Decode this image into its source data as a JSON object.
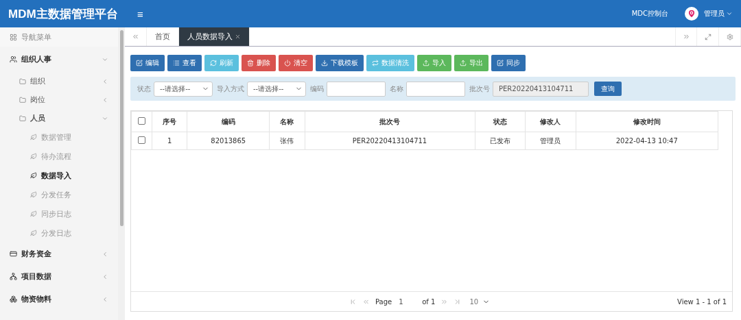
{
  "header": {
    "title": "MDM主数据管理平台",
    "menu_toggle": "≡",
    "console_link": "MDC控制台",
    "user": "管理员"
  },
  "sidebar": {
    "title": "导航菜单",
    "items": [
      {
        "label": "组织人事",
        "expanded": true,
        "children": [
          {
            "label": "组织",
            "expanded": false
          },
          {
            "label": "岗位",
            "expanded": false
          },
          {
            "label": "人员",
            "expanded": true,
            "children": [
              {
                "label": "数据管理",
                "selected": false
              },
              {
                "label": "待办流程",
                "selected": false
              },
              {
                "label": "数据导入",
                "selected": true
              },
              {
                "label": "分发任务",
                "selected": false
              },
              {
                "label": "同步日志",
                "selected": false
              },
              {
                "label": "分发日志",
                "selected": false
              }
            ]
          }
        ]
      },
      {
        "label": "财务资金",
        "expanded": false
      },
      {
        "label": "项目数据",
        "expanded": false
      },
      {
        "label": "物资物料",
        "expanded": false
      }
    ]
  },
  "tabs": [
    {
      "label": "首页",
      "selected": false,
      "closable": false
    },
    {
      "label": "人员数据导入",
      "selected": true,
      "closable": true
    }
  ],
  "toolbar": [
    {
      "label": "编辑",
      "kind": "primary"
    },
    {
      "label": "查看",
      "kind": "primary"
    },
    {
      "label": "刷新",
      "kind": "info"
    },
    {
      "label": "删除",
      "kind": "danger"
    },
    {
      "label": "清空",
      "kind": "danger"
    },
    {
      "label": "下载模板",
      "kind": "primary"
    },
    {
      "label": "数据清洗",
      "kind": "info"
    },
    {
      "label": "导入",
      "kind": "success"
    },
    {
      "label": "导出",
      "kind": "success"
    },
    {
      "label": "同步",
      "kind": "primary"
    }
  ],
  "filters": [
    {
      "label": "状态",
      "kind": "select",
      "value": "--请选择--"
    },
    {
      "label": "导入方式",
      "kind": "select",
      "value": "--请选择--"
    },
    {
      "label": "编码",
      "kind": "input"
    },
    {
      "label": "名称",
      "kind": "input"
    },
    {
      "label": "批次号",
      "kind": "input",
      "value": "PER20220413104711",
      "disabled": true
    }
  ],
  "search_button": "查询",
  "table": {
    "columns": [
      "序号",
      "编码",
      "名称",
      "批次号",
      "状态",
      "修改人",
      "修改时间"
    ],
    "rows": [
      {
        "checked": false,
        "cells": [
          "1",
          "82013865",
          "张伟",
          "PER20220413104711",
          "已发布",
          "管理员",
          "2022-04-13 10:47"
        ]
      }
    ],
    "header_checked": false
  },
  "pager": {
    "page_label": "Page",
    "page": "1",
    "of": "of 1",
    "page_size": "10",
    "summary": "View 1 - 1 of 1"
  }
}
